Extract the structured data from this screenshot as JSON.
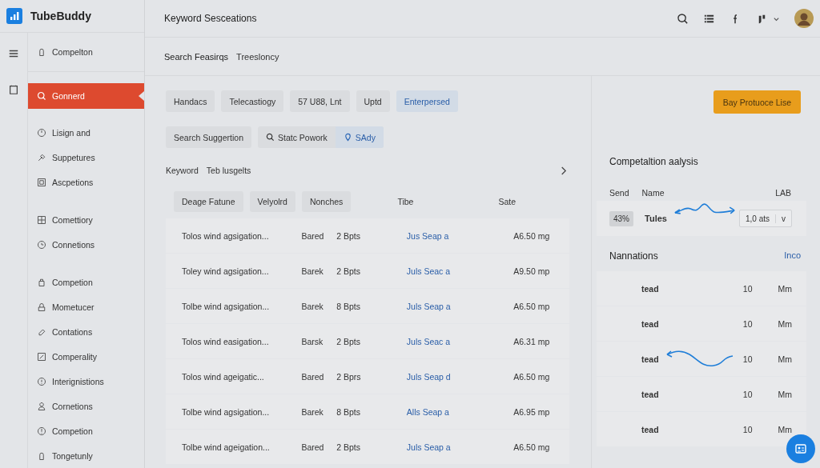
{
  "app": {
    "name": "TubeBuddy"
  },
  "header": {
    "title": "Keyword Sesceations"
  },
  "subheader": {
    "items": [
      "Search Feasirqs",
      "Treeslonсy"
    ]
  },
  "sidebar": {
    "groups": [
      {
        "items": [
          {
            "label": "Compelton",
            "selected": false
          }
        ]
      },
      {
        "items": [
          {
            "label": "Gonnerd",
            "selected": true
          }
        ]
      },
      {
        "items": [
          {
            "label": "Lisign and",
            "selected": false
          },
          {
            "label": "Suppetures",
            "selected": false
          },
          {
            "label": "Ascpetions",
            "selected": false
          }
        ]
      },
      {
        "items": [
          {
            "label": "Comettiory",
            "selected": false
          },
          {
            "label": "Connetions",
            "selected": false
          }
        ]
      },
      {
        "items": [
          {
            "label": "Competion",
            "selected": false
          },
          {
            "label": "Mometucer",
            "selected": false
          },
          {
            "label": "Contations",
            "selected": false
          },
          {
            "label": "Comperality",
            "selected": false
          },
          {
            "label": "Interignistions",
            "selected": false
          },
          {
            "label": "Cornetions",
            "selected": false
          },
          {
            "label": "Competion",
            "selected": false
          },
          {
            "label": "Tongetunly",
            "selected": false
          }
        ]
      }
    ]
  },
  "filters": [
    {
      "label": "Handacs",
      "selected": false
    },
    {
      "label": "Telecastiogy",
      "selected": false
    },
    {
      "label": "57 U88, Lnt",
      "selected": false
    },
    {
      "label": "Uptd",
      "selected": false
    },
    {
      "label": "Enterpersed",
      "selected": true
    }
  ],
  "search_row": {
    "button": "Search Suggertion",
    "segments": [
      {
        "label": "Statc Powork",
        "selected": false
      },
      {
        "label": "SAdy",
        "selected": true
      }
    ]
  },
  "results": {
    "title": "Keyword",
    "subtitle": "Teb lusgelts",
    "columns": [
      {
        "label": "Deage Fatune",
        "kind": "chip"
      },
      {
        "label": "Velyolrd",
        "kind": "chip"
      },
      {
        "label": "Nonches",
        "kind": "chip"
      },
      {
        "label": "Tibe",
        "kind": "plain"
      },
      {
        "label": "Sate",
        "kind": "plain"
      }
    ],
    "rows": [
      [
        "Tolos wind agsigation...",
        "Bared",
        "2 Bpts",
        "Jus Seap a",
        "A6.50 mg"
      ],
      [
        "Toley wind agsigation...",
        "Barek",
        "2 Bpts",
        "Juls Seac a",
        "A9.50 mp"
      ],
      [
        "Tolbe wind agsigation...",
        "Barek",
        "8 Bpts",
        "Juls Seap a",
        "A6.50 mp"
      ],
      [
        "Tolos wind easigation...",
        "Barsk",
        "2 Bpts",
        "Juls Seac a",
        "A6.31 mp"
      ],
      [
        "Tolos wind ageigatic...",
        "Bared",
        "2 Bprs",
        "Juls Seap d",
        "A6.50 mg"
      ],
      [
        "Tolbe wind agsigation...",
        "Barek",
        "8 Bpts",
        "Alls Seap a",
        "A6.95 mp"
      ],
      [
        "Tolbe wind ageigation...",
        "Bared",
        "2 Bpts",
        "Juls Seap a",
        "A6.50 mg"
      ]
    ]
  },
  "action_button": "Bay Protuoce Lise",
  "competition": {
    "title": "Competaltion aalysis",
    "columns": [
      "Send",
      "Name",
      "LAB"
    ],
    "row": {
      "badge": "43%",
      "name": "Tules",
      "select_value": "1,0 ats",
      "select_caret": "v"
    }
  },
  "nannations": {
    "title": "Nannations",
    "link": "Inco",
    "rows": [
      [
        "tead",
        "10",
        "Mm"
      ],
      [
        "tead",
        "10",
        "Mm"
      ],
      [
        "tead",
        "10",
        "Mm"
      ],
      [
        "tead",
        "10",
        "Mm"
      ],
      [
        "tead",
        "10",
        "Mm"
      ]
    ]
  }
}
